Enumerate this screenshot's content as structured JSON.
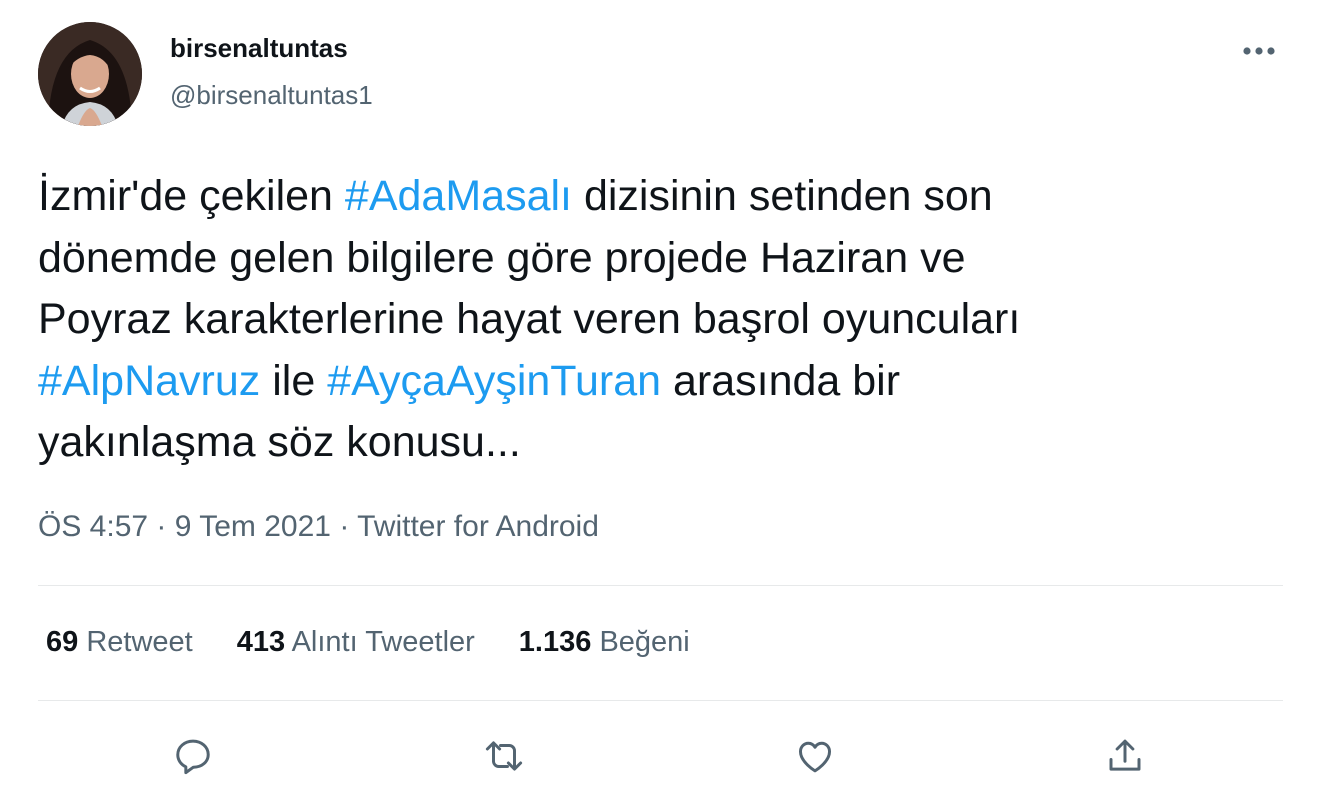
{
  "user": {
    "display_name": "birsenaltuntas",
    "handle": "@birsenaltuntas1",
    "avatar_icon": "profile-photo"
  },
  "tweet": {
    "lines": [
      [
        {
          "text": "İzmir'de çekilen "
        },
        {
          "text": "#AdaMasalı",
          "tag": true
        },
        {
          "text": " dizisinin setinden son"
        }
      ],
      [
        {
          "text": "dönemde gelen bilgilere göre projede Haziran ve"
        }
      ],
      [
        {
          "text": "Poyraz karakterlerine hayat veren başrol oyuncuları"
        }
      ],
      [
        {
          "text": "#AlpNavruz",
          "tag": true
        },
        {
          "text": " ile "
        },
        {
          "text": "#AyçaAyşinTuran",
          "tag": true
        },
        {
          "text": " arasında bir"
        }
      ],
      [
        {
          "text": "yakınlaşma söz konusu..."
        }
      ]
    ],
    "time": "ÖS 4:57",
    "date": "9 Tem 2021",
    "source": "Twitter for Android",
    "separator": "·"
  },
  "stats": {
    "retweets": {
      "count": "69",
      "label": "Retweet"
    },
    "quotes": {
      "count": "413",
      "label": "Alıntı Tweetler"
    },
    "likes": {
      "count": "1.136",
      "label": "Beğeni"
    }
  },
  "actions": [
    "reply-icon",
    "retweet-icon",
    "like-icon",
    "share-icon"
  ],
  "colors": {
    "hashtag": "#1d9bf0",
    "secondary_text": "#536471",
    "primary_text": "#0f1419",
    "divider": "#e7e9ea"
  }
}
